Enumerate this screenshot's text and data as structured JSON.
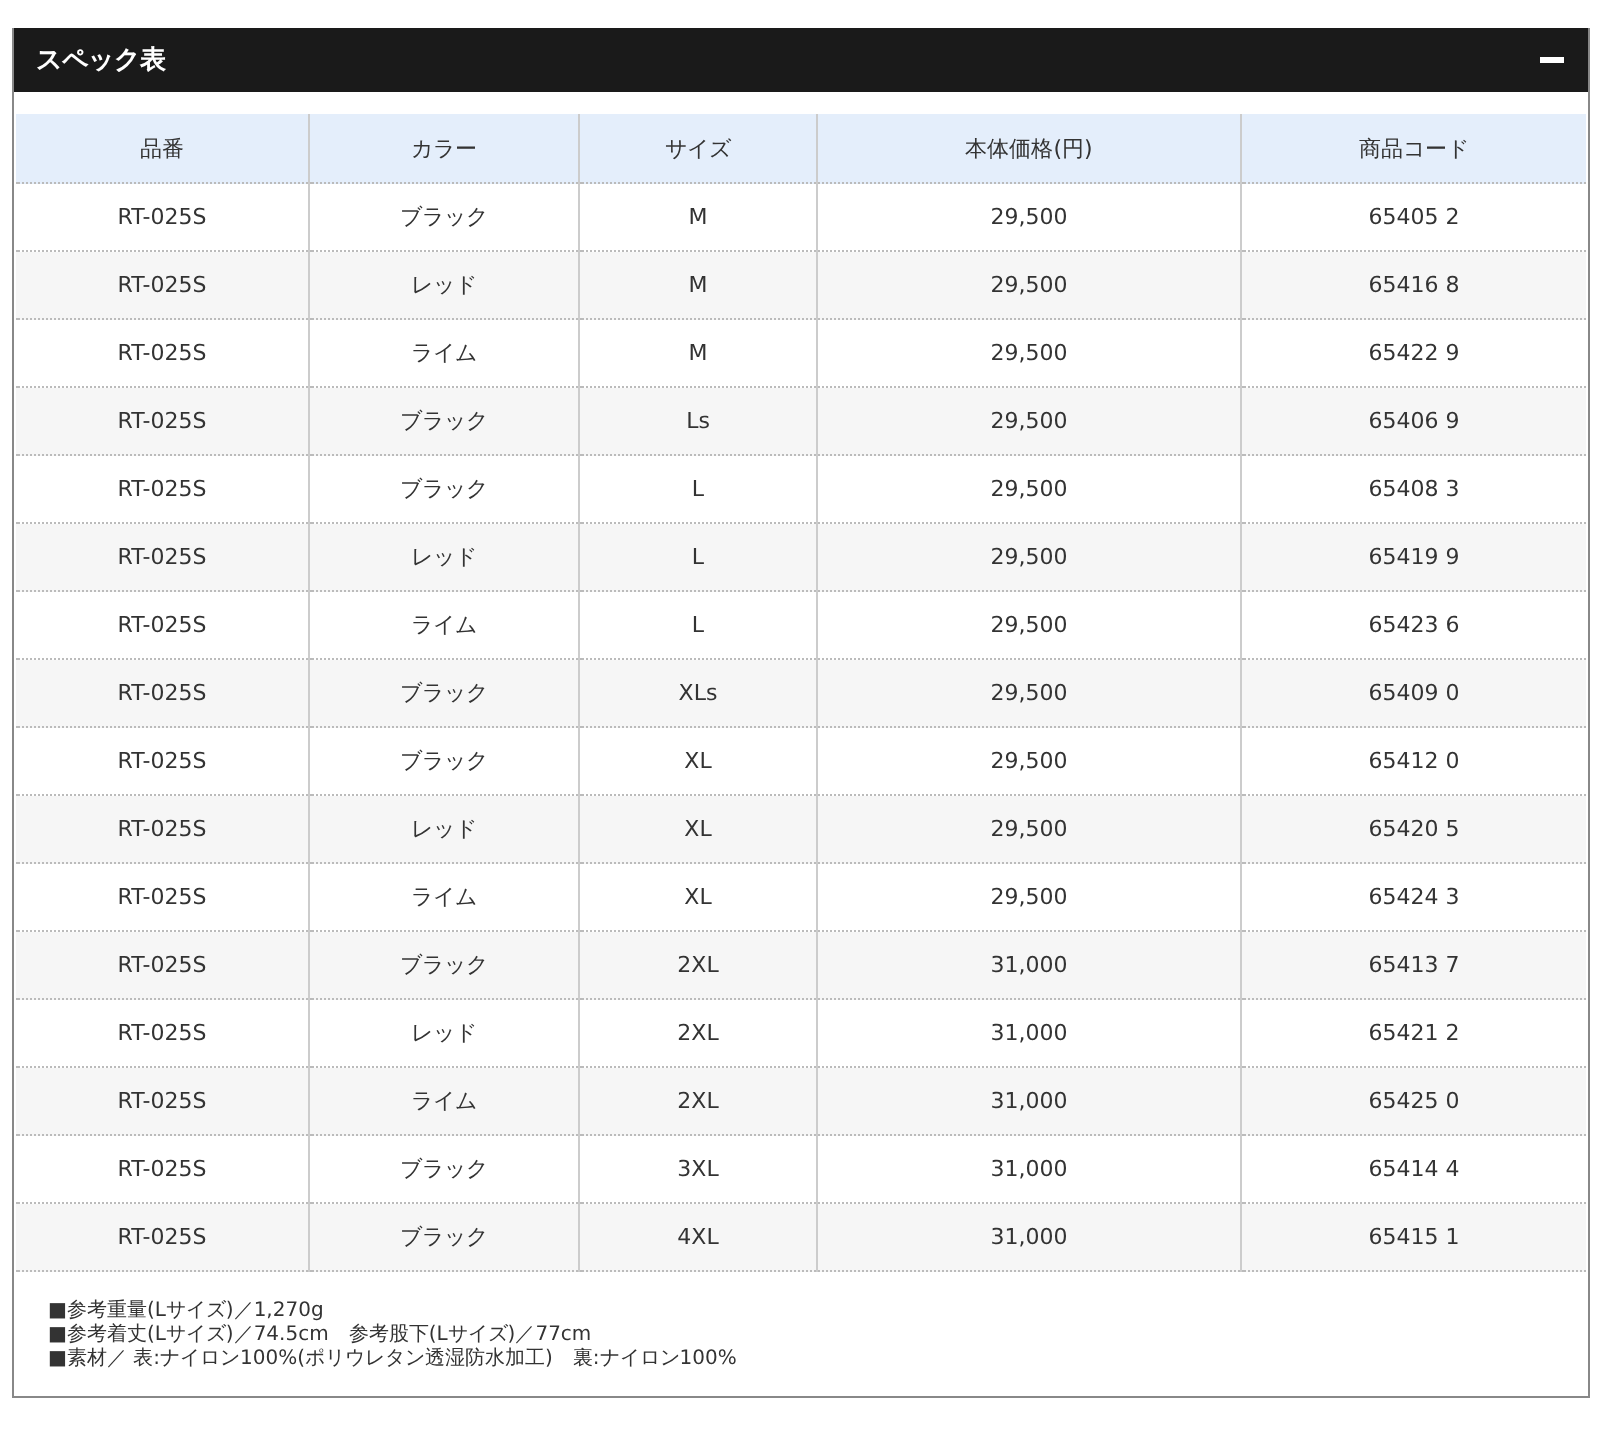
{
  "panel": {
    "title": "スペック表",
    "expanded": true
  },
  "table": {
    "columns": [
      "品番",
      "カラー",
      "サイズ",
      "本体価格(円)",
      "商品コード"
    ],
    "rows": [
      [
        "RT-025S",
        "ブラック",
        "M",
        "29,500",
        "65405 2"
      ],
      [
        "RT-025S",
        "レッド",
        "M",
        "29,500",
        "65416 8"
      ],
      [
        "RT-025S",
        "ライム",
        "M",
        "29,500",
        "65422 9"
      ],
      [
        "RT-025S",
        "ブラック",
        "Ls",
        "29,500",
        "65406 9"
      ],
      [
        "RT-025S",
        "ブラック",
        "L",
        "29,500",
        "65408 3"
      ],
      [
        "RT-025S",
        "レッド",
        "L",
        "29,500",
        "65419 9"
      ],
      [
        "RT-025S",
        "ライム",
        "L",
        "29,500",
        "65423 6"
      ],
      [
        "RT-025S",
        "ブラック",
        "XLs",
        "29,500",
        "65409 0"
      ],
      [
        "RT-025S",
        "ブラック",
        "XL",
        "29,500",
        "65412 0"
      ],
      [
        "RT-025S",
        "レッド",
        "XL",
        "29,500",
        "65420 5"
      ],
      [
        "RT-025S",
        "ライム",
        "XL",
        "29,500",
        "65424 3"
      ],
      [
        "RT-025S",
        "ブラック",
        "2XL",
        "31,000",
        "65413 7"
      ],
      [
        "RT-025S",
        "レッド",
        "2XL",
        "31,000",
        "65421 2"
      ],
      [
        "RT-025S",
        "ライム",
        "2XL",
        "31,000",
        "65425 0"
      ],
      [
        "RT-025S",
        "ブラック",
        "3XL",
        "31,000",
        "65414 4"
      ],
      [
        "RT-025S",
        "ブラック",
        "4XL",
        "31,000",
        "65415 1"
      ]
    ]
  },
  "notes": [
    "■参考重量(Lサイズ)／1,270g",
    "■参考着丈(Lサイズ)／74.5cm　参考股下(Lサイズ)／77cm",
    "■素材／ 表:ナイロン100%(ポリウレタン透湿防水加工)　裏:ナイロン100%"
  ]
}
